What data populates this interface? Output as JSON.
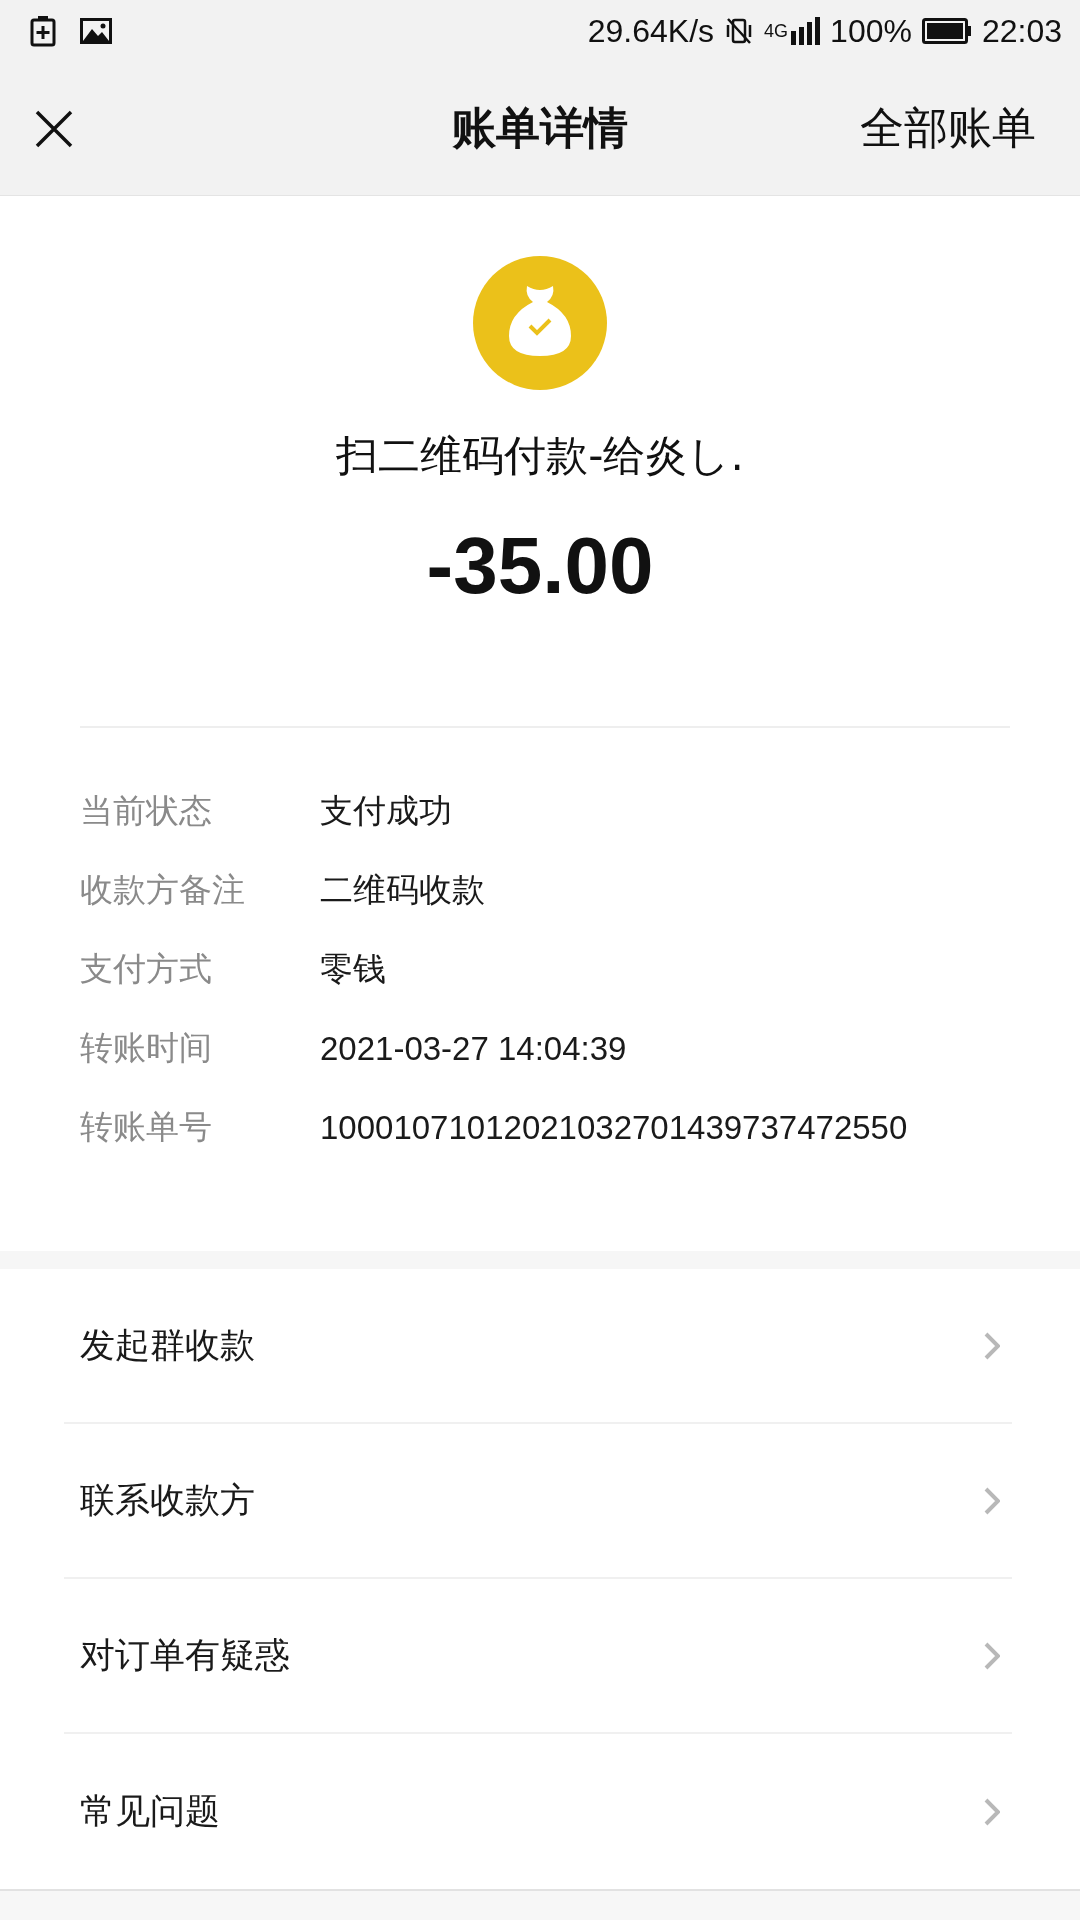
{
  "status_bar": {
    "network_speed": "29.64K/s",
    "network_type": "4G",
    "battery": "100%",
    "time": "22:03"
  },
  "header": {
    "title": "账单详情",
    "action": "全部账单"
  },
  "summary": {
    "title": "扫二维码付款-给炎し.",
    "amount": "-35.00"
  },
  "details": [
    {
      "label": "当前状态",
      "value": "支付成功"
    },
    {
      "label": "收款方备注",
      "value": "二维码收款"
    },
    {
      "label": "支付方式",
      "value": "零钱"
    },
    {
      "label": "转账时间",
      "value": "2021-03-27 14:04:39"
    },
    {
      "label": "转账单号",
      "value": "10001071012021032701439737472550"
    }
  ],
  "menu": [
    {
      "label": "发起群收款"
    },
    {
      "label": "联系收款方"
    },
    {
      "label": "对订单有疑惑"
    },
    {
      "label": "常见问题"
    }
  ]
}
